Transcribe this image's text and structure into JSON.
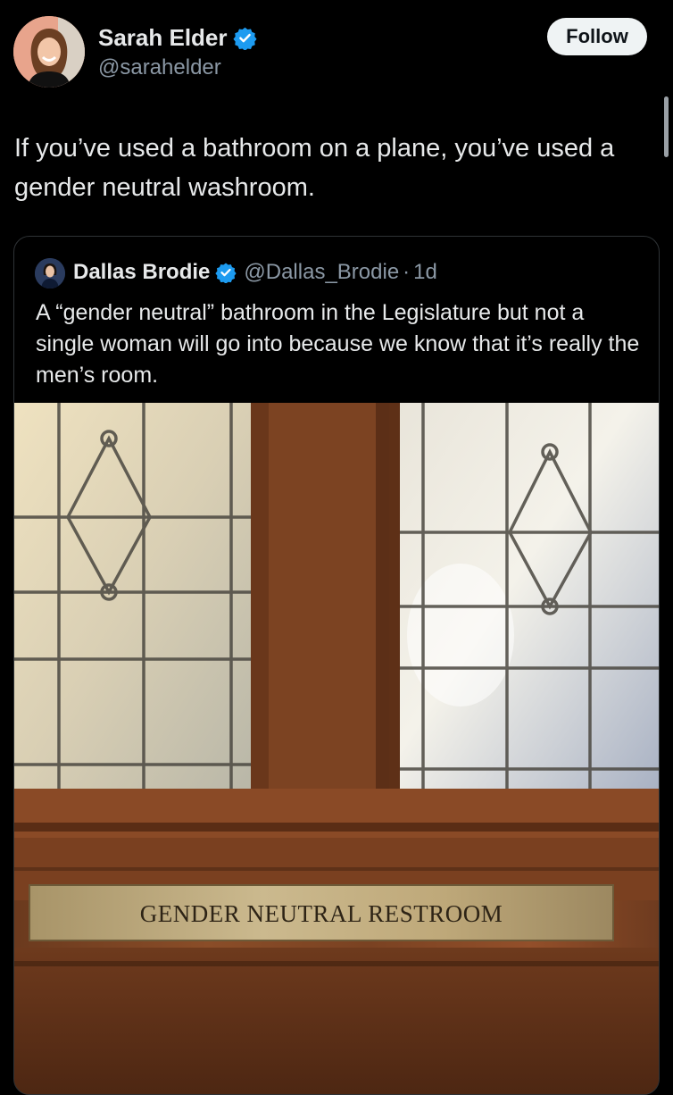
{
  "post": {
    "author_name": "Sarah Elder",
    "author_handle": "@sarahelder",
    "follow_label": "Follow",
    "text": "If you’ve used a bathroom on a plane, you’ve used a gender neutral washroom."
  },
  "quoted_post": {
    "author_name": "Dallas Brodie",
    "author_handle": "@Dallas_Brodie",
    "separator": "·",
    "time": "1d",
    "text": "A “gender neutral” bathroom in the Legislature but not a single woman will go into because we know that it’s really the men’s room.",
    "image": {
      "plaque_text": "GENDER NEUTRAL RESTROOM"
    }
  },
  "colors": {
    "background": "#000000",
    "text_primary": "#e7e9ea",
    "text_secondary": "#8b98a5",
    "verified_badge": "#1d9bf0",
    "follow_button_bg": "#eff3f4"
  },
  "icons": [
    "verified-badge-icon",
    "verified-badge-icon"
  ]
}
